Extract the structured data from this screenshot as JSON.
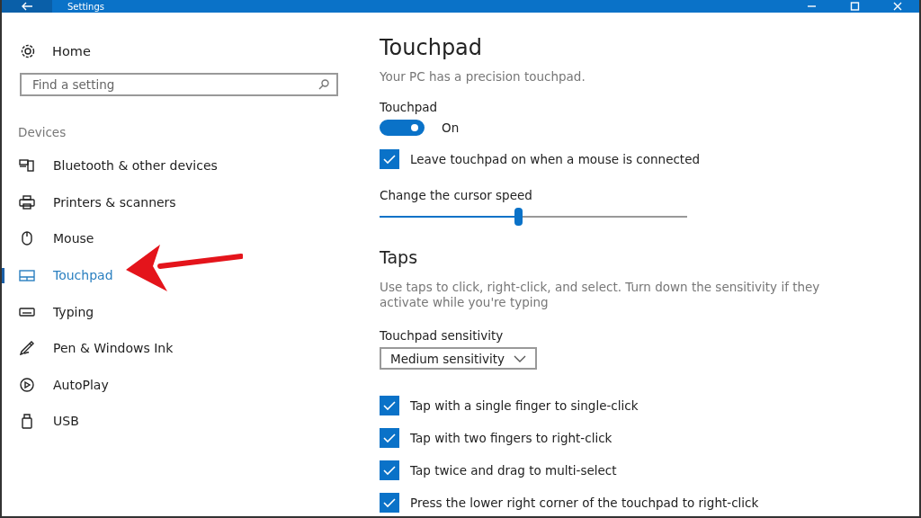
{
  "window": {
    "title": "Settings"
  },
  "sidebar": {
    "home": "Home",
    "search": {
      "placeholder": "Find a setting"
    },
    "section": "Devices",
    "items": [
      {
        "label": "Bluetooth & other devices",
        "selected": false
      },
      {
        "label": "Printers & scanners",
        "selected": false
      },
      {
        "label": "Mouse",
        "selected": false
      },
      {
        "label": "Touchpad",
        "selected": true
      },
      {
        "label": "Typing",
        "selected": false
      },
      {
        "label": "Pen & Windows Ink",
        "selected": false
      },
      {
        "label": "AutoPlay",
        "selected": false
      },
      {
        "label": "USB",
        "selected": false
      }
    ]
  },
  "content": {
    "title": "Touchpad",
    "subtitle": "Your PC has a precision touchpad.",
    "toggle": {
      "label": "Touchpad",
      "on": true,
      "state_text": "On"
    },
    "leave_on": {
      "label": "Leave touchpad on when a mouse is connected",
      "checked": true
    },
    "cursor_speed": {
      "label": "Change the cursor speed",
      "level": 0.45
    },
    "taps": {
      "heading": "Taps",
      "description": "Use taps to click, right-click, and select. Turn down the sensitivity if they activate while you're typing",
      "sensitivity": {
        "label": "Touchpad sensitivity",
        "value": "Medium sensitivity"
      },
      "options": [
        {
          "label": "Tap with a single finger to single-click",
          "checked": true
        },
        {
          "label": "Tap with two fingers to right-click",
          "checked": true
        },
        {
          "label": "Tap twice and drag to multi-select",
          "checked": true
        },
        {
          "label": "Press the lower right corner of the touchpad to right-click",
          "checked": true
        }
      ]
    }
  }
}
